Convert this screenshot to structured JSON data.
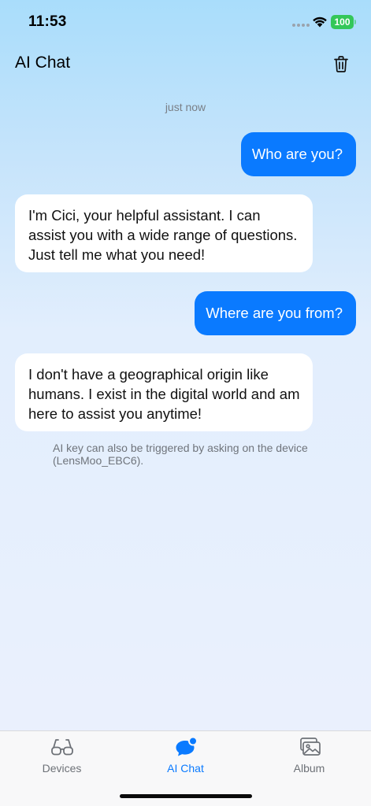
{
  "status_bar": {
    "time": "11:53",
    "battery": "100",
    "battery_color": "#34c759"
  },
  "header": {
    "title": "AI Chat",
    "trash_icon": "trash-icon"
  },
  "chat": {
    "timestamp": "just now",
    "messages": [
      {
        "role": "user",
        "text": "Who are you?"
      },
      {
        "role": "assistant",
        "lines": [
          "I'm Cici, your helpful assistant. I can",
          "assist you with a wide range of questions.",
          "Just tell me what you need!"
        ]
      },
      {
        "role": "user",
        "text": "Where are you from?"
      },
      {
        "role": "assistant",
        "lines": [
          "I don't have a geographical origin like",
          "humans. I exist in the digital world and am",
          "here to assist you anytime!"
        ]
      }
    ],
    "hint_lines": [
      "AI key can also be triggered by asking on the device",
      "(LensMoo_EBC6)."
    ]
  },
  "tab_bar": {
    "tabs": [
      {
        "label": "Devices",
        "icon": "glasses-icon",
        "active": false
      },
      {
        "label": "AI Chat",
        "icon": "chat-bubble-icon",
        "active": true
      },
      {
        "label": "Album",
        "icon": "photo-album-icon",
        "active": false
      }
    ],
    "accent": "#0a7aff"
  }
}
